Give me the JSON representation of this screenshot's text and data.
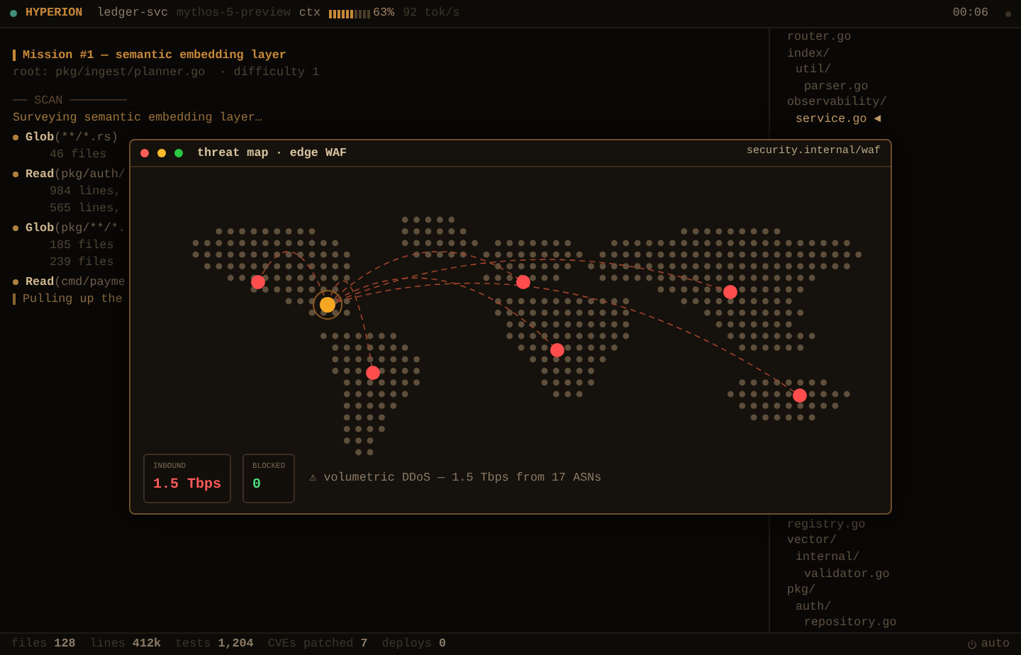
{
  "top_bar": {
    "app": "HYPERION",
    "project": "ledger-svc",
    "model": "mythos-5-preview",
    "ctx_label": "ctx",
    "ctx": {
      "level": 0.63
    },
    "ctx_reading": "63%",
    "speed": "92 tok/s",
    "clock": "00:06"
  },
  "terminal": {
    "mission": "Mission #1 — semantic embedding layer",
    "root": "root: pkg/ingest/planner.go  · difficulty 1",
    "section": "── SCAN ────────",
    "lines": [
      {
        "kind": "status",
        "text": "Surveying semantic embedding layer…"
      },
      {
        "kind": "call",
        "tool": "Glob",
        "args": "(**/*.rs)"
      },
      {
        "kind": "result",
        "text": "46 files"
      },
      {
        "kind": "call",
        "tool": "Read",
        "args": "(pkg/auth/"
      },
      {
        "kind": "result",
        "text": "984 lines,"
      },
      {
        "kind": "result",
        "text": "565 lines,"
      },
      {
        "kind": "call",
        "tool": "Glob",
        "args": "(pkg/**/*."
      },
      {
        "kind": "result",
        "text": "185 files"
      },
      {
        "kind": "result",
        "text": "239 files"
      },
      {
        "kind": "call",
        "tool": "Read",
        "args": "(cmd/payme"
      },
      {
        "kind": "pending",
        "text": "Pulling up the"
      }
    ]
  },
  "tree": {
    "marker": "◄",
    "top": [
      {
        "label": "router.go",
        "selected": false
      },
      {
        "label": "index/",
        "selected": false,
        "children": [
          {
            "label": "util/",
            "selected": false,
            "children": [
              {
                "label": "parser.go",
                "selected": false
              }
            ]
          }
        ]
      },
      {
        "label": "observability/",
        "selected": false,
        "children": [
          {
            "label": "service.go",
            "selected": true
          }
        ]
      }
    ],
    "bottom": [
      {
        "label": "registry.go",
        "selected": false
      },
      {
        "label": "vector/",
        "selected": false,
        "children": [
          {
            "label": "internal/",
            "selected": false,
            "children": [
              {
                "label": "validator.go",
                "selected": false
              }
            ]
          }
        ]
      },
      {
        "label": "pkg/",
        "selected": false,
        "children": [
          {
            "label": "auth/",
            "selected": false,
            "children": [
              {
                "label": "repository.go",
                "selected": false
              }
            ]
          }
        ]
      }
    ]
  },
  "threat_window": {
    "title": "threat map · edge WAF",
    "host": "security.internal/waf",
    "stats": [
      {
        "label": "INBOUND",
        "value": "1.5 Tbps",
        "color": "#ff5a5a"
      },
      {
        "label": "BLOCKED",
        "value": "0",
        "color": "#4ade80"
      }
    ],
    "alert": "⚠ volumetric DDoS — 1.5 Tbps from 17 ASNs"
  },
  "status_bar": {
    "items": [
      {
        "label": "files",
        "value": "128"
      },
      {
        "label": "lines",
        "value": "412k"
      },
      {
        "label": "tests",
        "value": "1,204"
      },
      {
        "label": "CVEs patched",
        "value": "7"
      },
      {
        "label": "deploys",
        "value": "0"
      }
    ],
    "mode": "auto"
  }
}
